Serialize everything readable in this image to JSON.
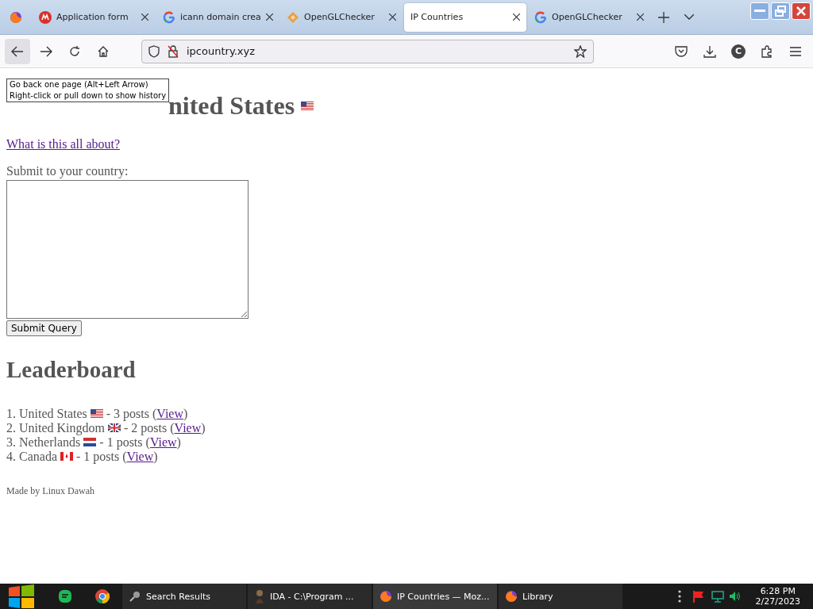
{
  "tabs": [
    {
      "kind": "mp",
      "title": "Application form",
      "selected": false
    },
    {
      "kind": "google",
      "title": "icann domain crea",
      "selected": false
    },
    {
      "kind": "diamond",
      "title": "OpenGLChecker",
      "selected": false
    },
    {
      "kind": "none",
      "title": "IP Countries",
      "selected": true
    },
    {
      "kind": "google",
      "title": "OpenGLChecker",
      "selected": false
    }
  ],
  "address": "ipcountry.xyz",
  "account_initial": "C",
  "tooltip": [
    "Go back one page (Alt+Left Arrow)",
    "Right-click or pull down to show history"
  ],
  "page": {
    "heading": {
      "text": "nited States",
      "kind": "us"
    },
    "about_link": "What is this all about?",
    "submit_label": "Submit to your country:",
    "submit_button": "Submit Query",
    "leaderboard_title": "Leaderboard",
    "leaderboard": [
      {
        "rank": "1.",
        "country": "United States",
        "kind": "us",
        "posts": "- 3 posts (",
        "link": "View",
        "close": ")"
      },
      {
        "rank": "2.",
        "country": "United Kingdom",
        "kind": "uk",
        "posts": "- 2 posts (",
        "link": "View",
        "close": ")"
      },
      {
        "rank": "3.",
        "country": "Netherlands",
        "kind": "nl",
        "posts": "- 1 posts (",
        "link": "View",
        "close": ")"
      },
      {
        "rank": "4.",
        "country": "Canada",
        "kind": "ca",
        "posts": "- 1 posts (",
        "link": "View",
        "close": ")"
      }
    ],
    "footer": "Made by Linux Dawah"
  },
  "taskbar": {
    "tasks": [
      {
        "kind": "search",
        "title": "Search Results",
        "selected": false
      },
      {
        "kind": "figure",
        "title": "IDA - C:\\Program ...",
        "selected": false
      },
      {
        "kind": "firefox",
        "title": "IP Countries — Moz...",
        "selected": true
      },
      {
        "kind": "firefox",
        "title": "Library",
        "selected": false
      }
    ],
    "time": "6:28 PM",
    "date": "2/27/2023"
  }
}
